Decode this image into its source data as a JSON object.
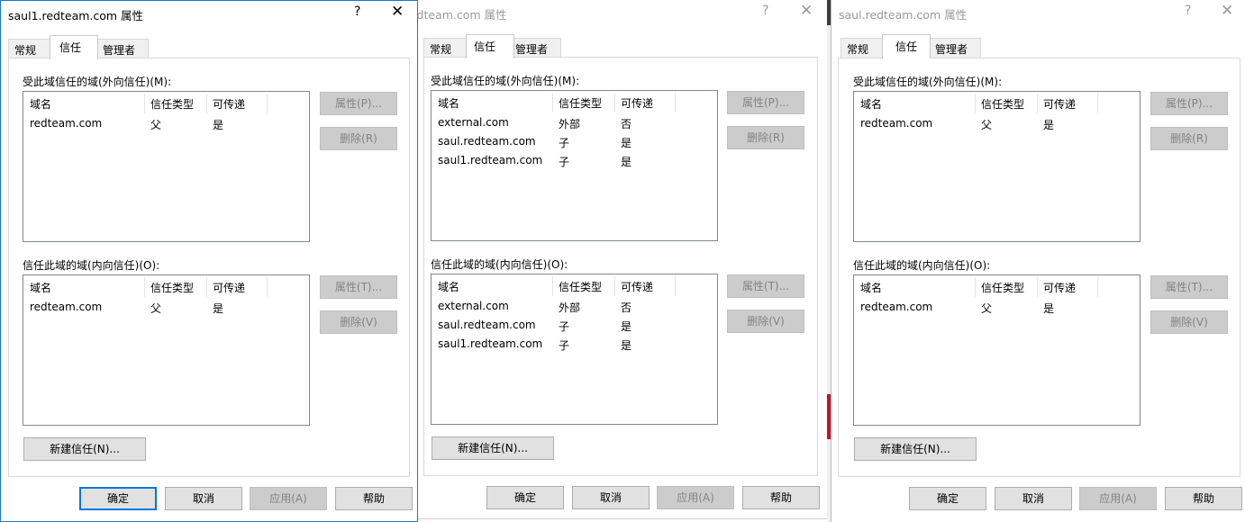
{
  "dialogs": [
    {
      "title": "saul1.redteam.com 属性",
      "help": "?",
      "close": "✕",
      "tabs": [
        "常规",
        "信任",
        "管理者"
      ],
      "outgoing": {
        "label": "受此域信任的域(外向信任)(M):",
        "columns": [
          "域名",
          "信任类型",
          "可传递"
        ],
        "rows": [
          [
            "redteam.com",
            "父",
            "是"
          ]
        ],
        "properties": "属性(P)...",
        "remove": "删除(R)"
      },
      "incoming": {
        "label": "信任此域的域(内向信任)(O):",
        "columns": [
          "域名",
          "信任类型",
          "可传递"
        ],
        "rows": [
          [
            "redteam.com",
            "父",
            "是"
          ]
        ],
        "properties": "属性(T)...",
        "remove": "删除(V)"
      },
      "new_trust": "新建信任(N)...",
      "ok": "确定",
      "cancel": "取消",
      "apply": "应用(A)",
      "helpbtn": "帮助"
    },
    {
      "title": "redteam.com 属性",
      "help": "?",
      "close": "✕",
      "tabs": [
        "常规",
        "信任",
        "管理者"
      ],
      "outgoing": {
        "label": "受此域信任的域(外向信任)(M):",
        "columns": [
          "域名",
          "信任类型",
          "可传递"
        ],
        "rows": [
          [
            "external.com",
            "外部",
            "否"
          ],
          [
            "saul.redteam.com",
            "子",
            "是"
          ],
          [
            "saul1.redteam.com",
            "子",
            "是"
          ]
        ],
        "properties": "属性(P)...",
        "remove": "删除(R)"
      },
      "incoming": {
        "label": "信任此域的域(内向信任)(O):",
        "columns": [
          "域名",
          "信任类型",
          "可传递"
        ],
        "rows": [
          [
            "external.com",
            "外部",
            "否"
          ],
          [
            "saul.redteam.com",
            "子",
            "是"
          ],
          [
            "saul1.redteam.com",
            "子",
            "是"
          ]
        ],
        "properties": "属性(T)...",
        "remove": "删除(V)"
      },
      "new_trust": "新建信任(N)...",
      "ok": "确定",
      "cancel": "取消",
      "apply": "应用(A)",
      "helpbtn": "帮助"
    },
    {
      "title": "saul.redteam.com 属性",
      "help": "?",
      "close": "✕",
      "tabs": [
        "常规",
        "信任",
        "管理者"
      ],
      "outgoing": {
        "label": "受此域信任的域(外向信任)(M):",
        "columns": [
          "域名",
          "信任类型",
          "可传递"
        ],
        "rows": [
          [
            "redteam.com",
            "父",
            "是"
          ]
        ],
        "properties": "属性(P)...",
        "remove": "删除(R)"
      },
      "incoming": {
        "label": "信任此域的域(内向信任)(O):",
        "columns": [
          "域名",
          "信任类型",
          "可传递"
        ],
        "rows": [
          [
            "redteam.com",
            "父",
            "是"
          ]
        ],
        "properties": "属性(T)...",
        "remove": "删除(V)"
      },
      "new_trust": "新建信任(N)...",
      "ok": "确定",
      "cancel": "取消",
      "apply": "应用(A)",
      "helpbtn": "帮助"
    }
  ],
  "colors": {
    "active_border": "#1979ca",
    "default_button": "#0078d7",
    "disabled_button": "#cccccc",
    "taskbar_red": "#c8102e"
  }
}
